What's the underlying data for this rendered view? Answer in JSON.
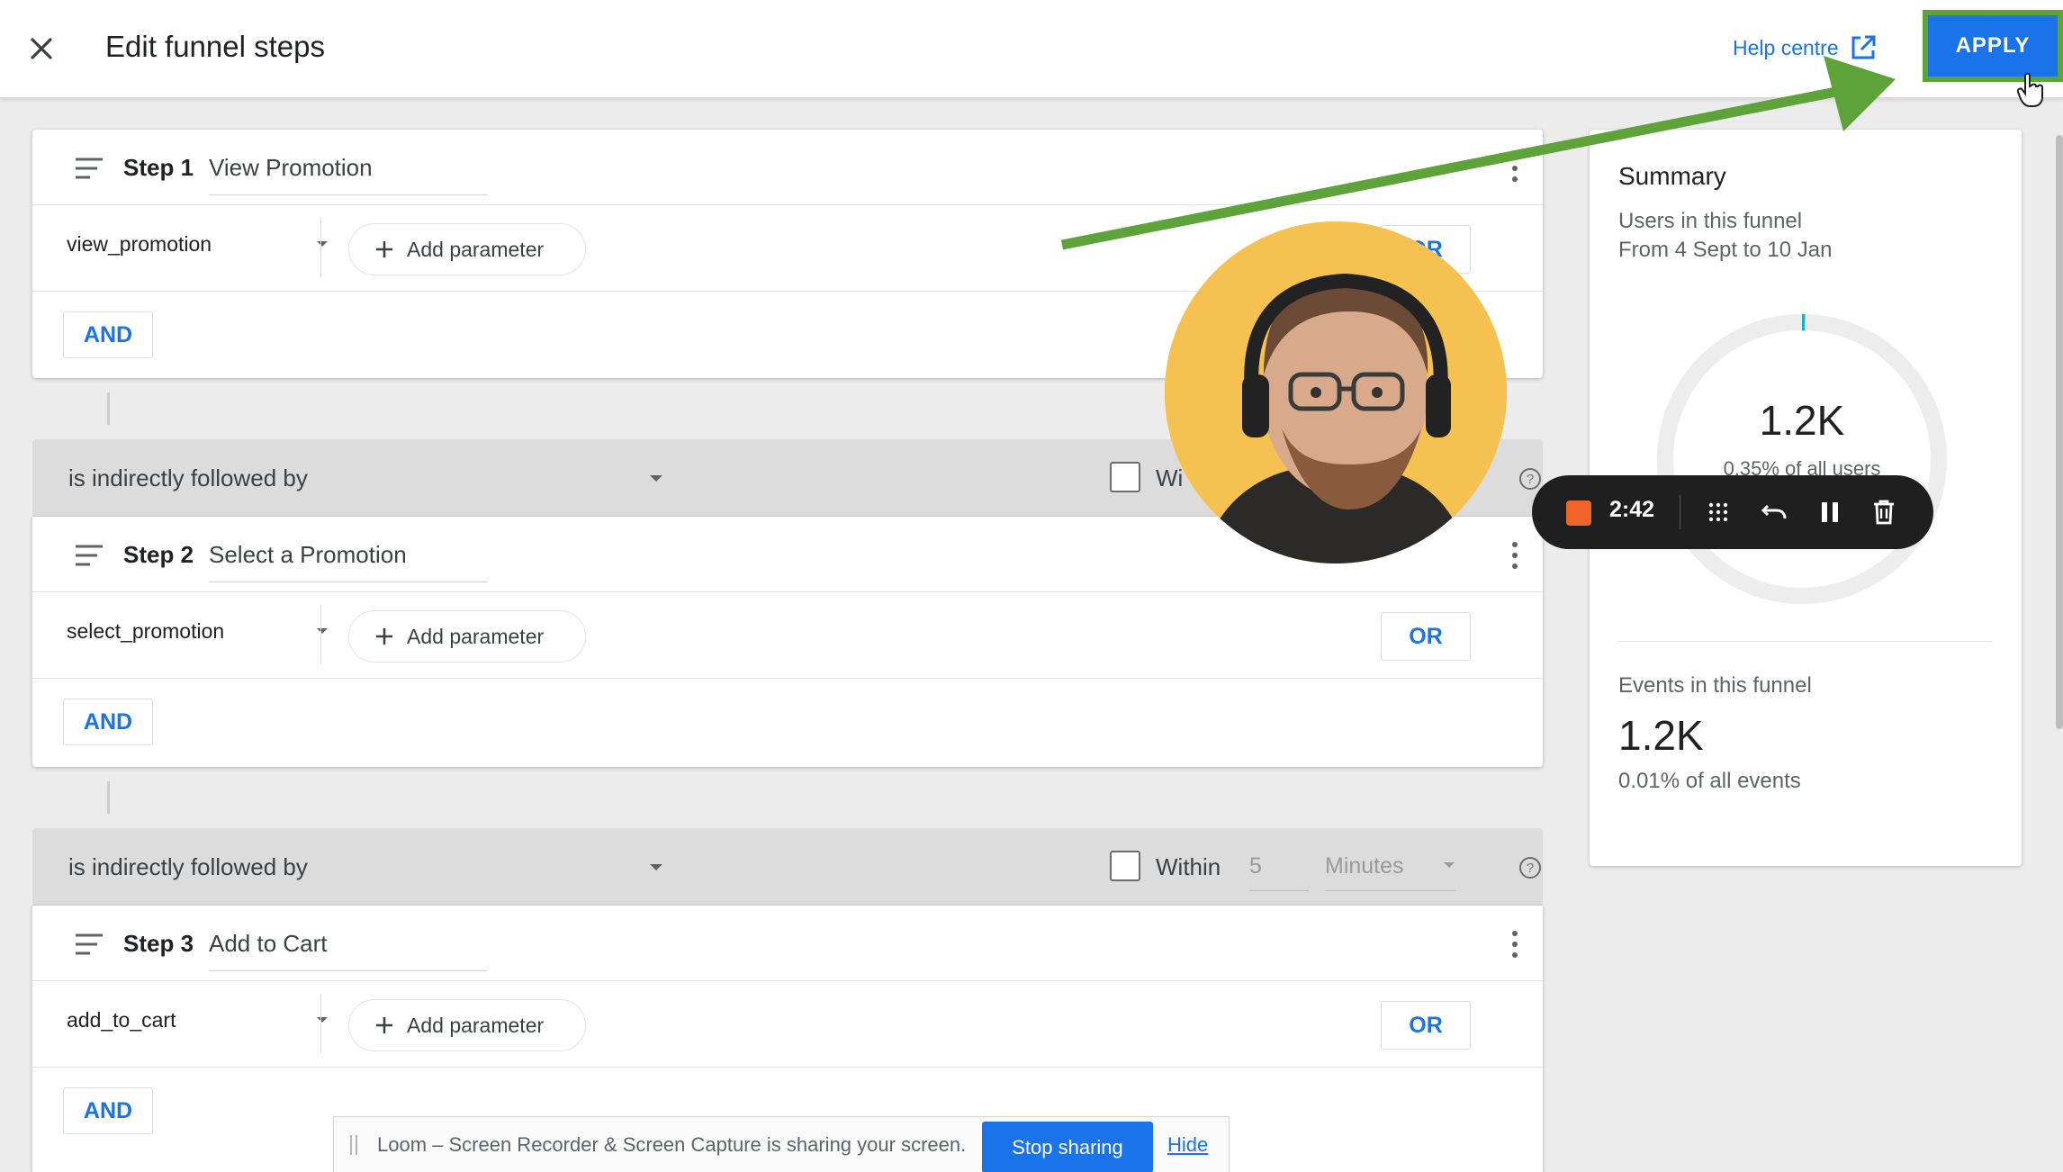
{
  "header": {
    "title": "Edit funnel steps",
    "help_label": "Help centre",
    "apply_label": "APPLY"
  },
  "steps": [
    {
      "label": "Step 1",
      "name": "View Promotion",
      "event": "view_promotion",
      "add_param": "Add parameter",
      "or_label": "OR",
      "and_label": "AND"
    },
    {
      "label": "Step 2",
      "name": "Select a Promotion",
      "event": "select_promotion",
      "add_param": "Add parameter",
      "or_label": "OR",
      "and_label": "AND"
    },
    {
      "label": "Step 3",
      "name": "Add to Cart",
      "event": "add_to_cart",
      "add_param": "Add parameter",
      "or_label": "OR",
      "and_label": "AND"
    }
  ],
  "followed": [
    {
      "condition": "is indirectly followed by",
      "within_label": "Wi",
      "within_value": "",
      "within_unit": "",
      "help": "?"
    },
    {
      "condition": "is indirectly followed by",
      "within_label": "Within",
      "within_value": "5",
      "within_unit": "Minutes",
      "help": "?"
    }
  ],
  "summary": {
    "title": "Summary",
    "users_label": "Users in this funnel",
    "date_range": "From 4 Sept to 10 Jan",
    "users_value": "1.2K",
    "users_pct": "0.35% of all users",
    "events_label": "Events in this funnel",
    "events_value": "1.2K",
    "events_pct": "0.01% of all events",
    "funnel_fraction": 0.0035
  },
  "recorder": {
    "time": "2:42"
  },
  "share_bar": {
    "message": "Loom – Screen Recorder & Screen Capture is sharing your screen.",
    "stop_label": "Stop sharing",
    "hide_label": "Hide"
  },
  "colors": {
    "accent": "#1a73e8",
    "annotation": "#5ea33a",
    "record": "#f0642a",
    "avatar_bg": "#f5c251"
  }
}
